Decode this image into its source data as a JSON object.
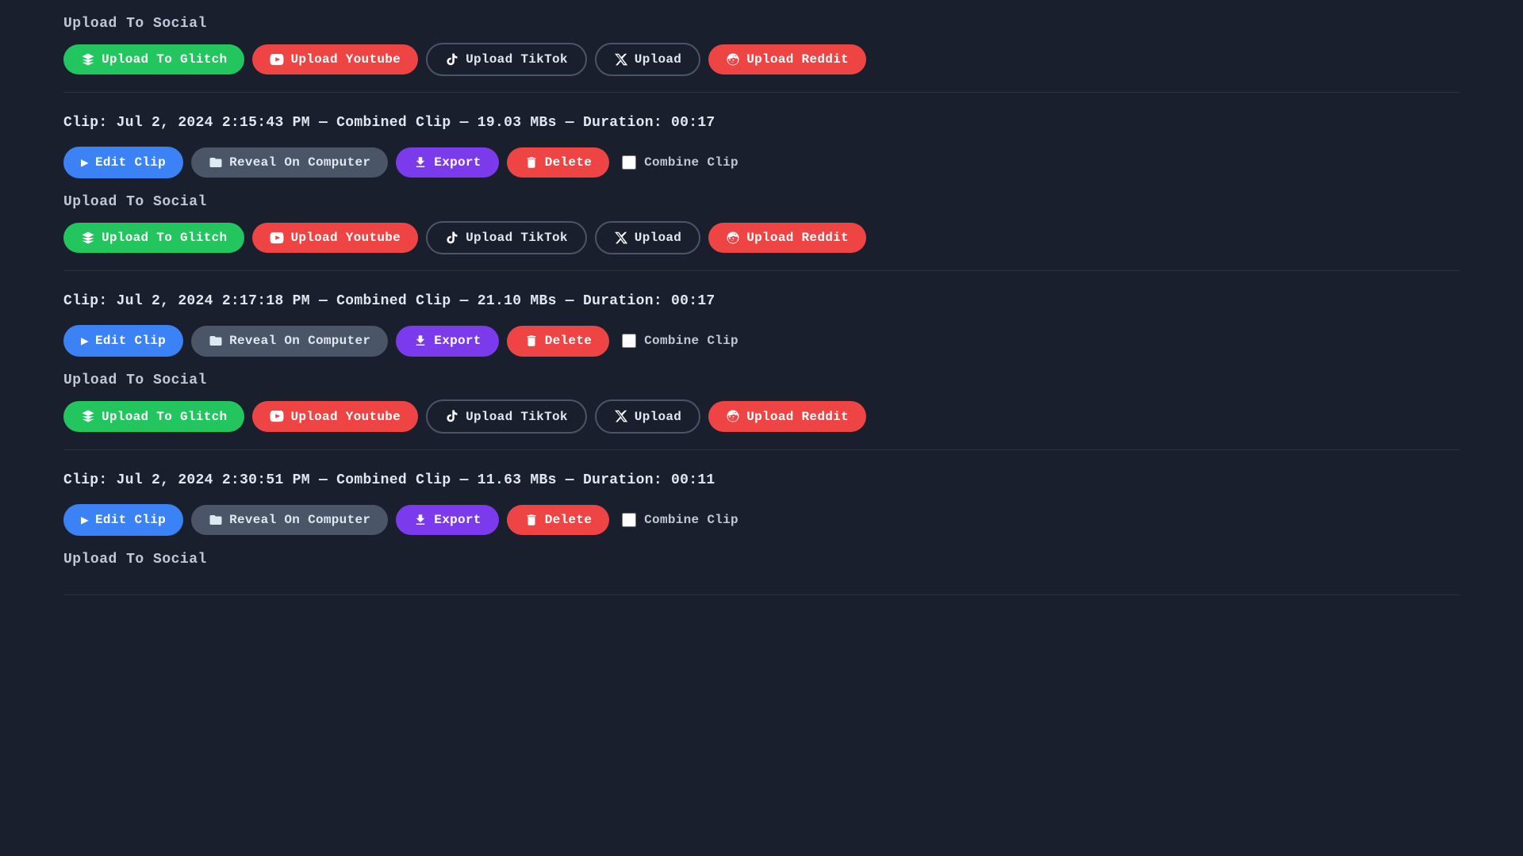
{
  "topSection": {
    "uploadToSocialLabel": "Upload To Social",
    "buttons": {
      "uploadToGlitch": "Upload To Glitch",
      "uploadYoutube": "Upload Youtube",
      "uploadTikTok": "Upload TikTok",
      "upload": "Upload",
      "uploadReddit": "Upload Reddit"
    }
  },
  "clips": [
    {
      "id": "clip-1",
      "info": "Clip: Jul 2, 2024 2:15:43 PM — Combined Clip — 19.03 MBs — Duration: 00:17",
      "uploadToSocialLabel": "Upload To Social",
      "actions": {
        "editClip": "Edit Clip",
        "revealOnComputer": "Reveal On Computer",
        "export": "Export",
        "delete": "Delete",
        "combineClip": "Combine Clip"
      }
    },
    {
      "id": "clip-2",
      "info": "Clip: Jul 2, 2024 2:17:18 PM — Combined Clip — 21.10 MBs — Duration: 00:17",
      "uploadToSocialLabel": "Upload To Social",
      "actions": {
        "editClip": "Edit Clip",
        "revealOnComputer": "Reveal On Computer",
        "export": "Export",
        "delete": "Delete",
        "combineClip": "Combine Clip"
      }
    },
    {
      "id": "clip-3",
      "info": "Clip: Jul 2, 2024 2:30:51 PM — Combined Clip — 11.63 MBs — Duration: 00:11",
      "uploadToSocialLabel": "Upload To Social",
      "actions": {
        "editClip": "Edit Clip",
        "revealOnComputer": "Reveal On Computer",
        "export": "Export",
        "delete": "Delete",
        "combineClip": "Combine Clip"
      }
    }
  ],
  "colors": {
    "glitch": "#22c55e",
    "youtube": "#ef4444",
    "tiktok": "#1a1f2e",
    "x": "#1a1f2e",
    "reddit": "#ef4444",
    "edit": "#3b82f6",
    "reveal": "#4a5568",
    "export": "#7c3aed",
    "delete": "#ef4444"
  }
}
